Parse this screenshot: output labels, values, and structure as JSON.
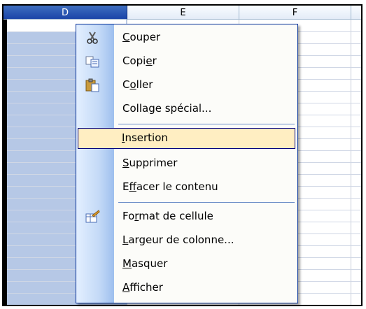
{
  "columns": {
    "D": "D",
    "E": "E",
    "F": "F"
  },
  "menu": {
    "items": [
      {
        "key": "cut",
        "pre": "",
        "accel": "C",
        "post": "ouper",
        "icon": "scissors-icon"
      },
      {
        "key": "copy",
        "pre": "Copi",
        "accel": "e",
        "post": "r",
        "icon": "copy-icon"
      },
      {
        "key": "paste",
        "pre": "C",
        "accel": "o",
        "post": "ller",
        "icon": "paste-icon"
      },
      {
        "key": "paste-special",
        "pre": "Colla",
        "accel": "g",
        "post": "e spécial...",
        "icon": ""
      },
      {
        "key": "insert",
        "pre": "",
        "accel": "I",
        "post": "nsertion",
        "icon": "",
        "highlighted": true
      },
      {
        "key": "delete",
        "pre": "",
        "accel": "S",
        "post": "upprimer",
        "icon": ""
      },
      {
        "key": "clear-contents",
        "pre": "E",
        "accel": "f",
        "post": "facer le contenu",
        "icon": ""
      },
      {
        "key": "format-cells",
        "pre": "Fo",
        "accel": "r",
        "post": "mat de cellule",
        "icon": "format-cells-icon"
      },
      {
        "key": "column-width",
        "pre": "",
        "accel": "L",
        "post": "argeur de colonne...",
        "icon": ""
      },
      {
        "key": "hide",
        "pre": "",
        "accel": "M",
        "post": "asquer",
        "icon": ""
      },
      {
        "key": "unhide",
        "pre": "",
        "accel": "A",
        "post": "fficher",
        "icon": ""
      }
    ]
  },
  "colors": {
    "highlight_bg": "#ffeec2",
    "highlight_border": "#000080",
    "selected_header": "#1a44a8",
    "selected_column": "#b6c8e6"
  }
}
